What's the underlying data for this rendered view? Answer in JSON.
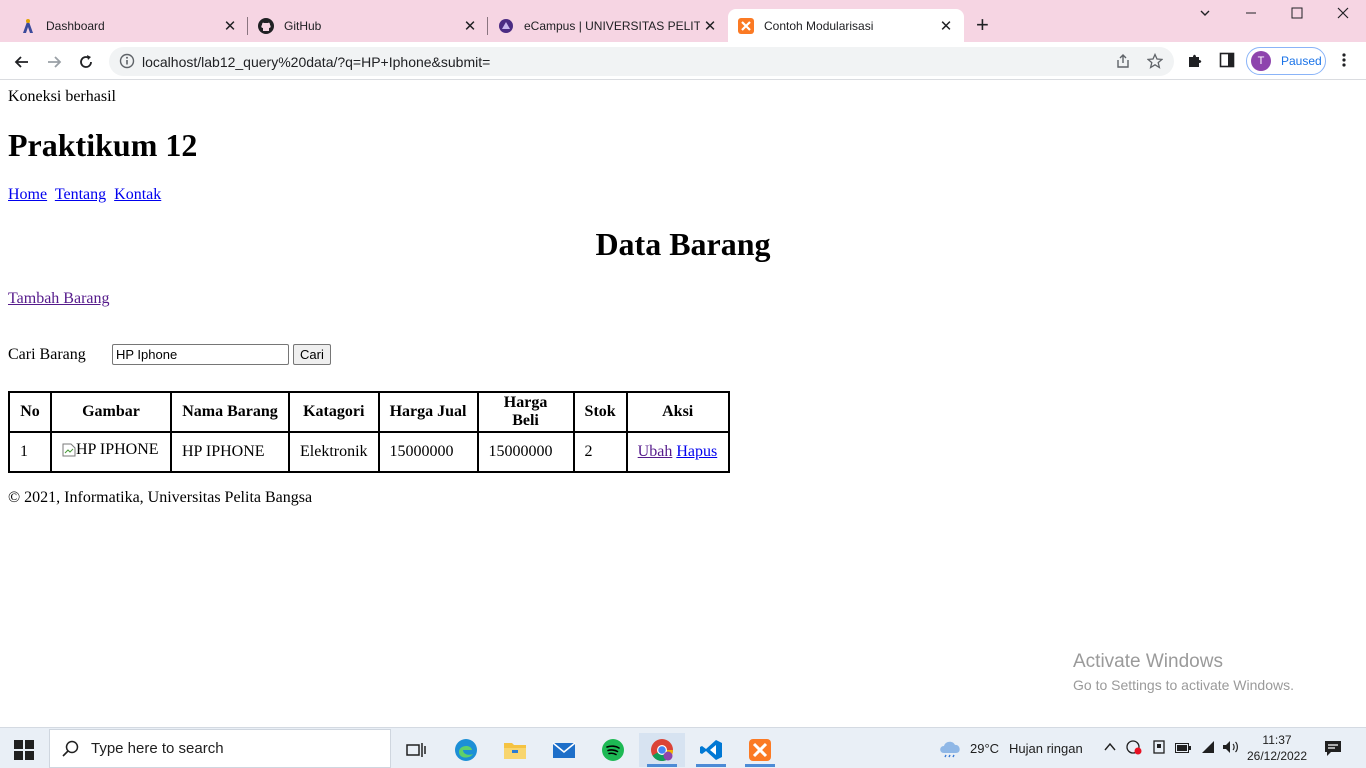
{
  "browser": {
    "tabs": [
      {
        "title": "Dashboard",
        "active": false
      },
      {
        "title": "GitHub",
        "active": false
      },
      {
        "title": "eCampus | UNIVERSITAS PELITA B",
        "active": false
      },
      {
        "title": "Contoh Modularisasi",
        "active": true
      }
    ],
    "address_url": "localhost/lab12_query%20data/?q=HP+Iphone&submit=",
    "profile_initial": "T",
    "profile_status": "Paused"
  },
  "page": {
    "connection_status": "Koneksi berhasil",
    "site_title": "Praktikum 12",
    "nav_links": [
      "Home",
      "Tentang",
      "Kontak"
    ],
    "heading": "Data Barang",
    "add_link": "Tambah Barang",
    "search": {
      "label": "Cari Barang",
      "value": "HP Iphone",
      "button": "Cari"
    },
    "table": {
      "headers": [
        "No",
        "Gambar",
        "Nama Barang",
        "Katagori",
        "Harga Jual",
        "Harga Beli",
        "Stok",
        "Aksi"
      ],
      "rows": [
        {
          "no": "1",
          "gambar_alt": "HP IPHONE",
          "nama": "HP IPHONE",
          "kategori": "Elektronik",
          "harga_jual": "15000000",
          "harga_beli": "15000000",
          "stok": "2",
          "ubah": "Ubah",
          "hapus": "Hapus"
        }
      ]
    },
    "footer": "© 2021, Informatika, Universitas Pelita Bangsa"
  },
  "watermark": {
    "line1": "Activate Windows",
    "line2": "Go to Settings to activate Windows."
  },
  "taskbar": {
    "search_placeholder": "Type here to search",
    "weather_temp": "29°C",
    "weather_desc": "Hujan ringan",
    "time": "11:37",
    "date": "26/12/2022"
  },
  "colors": {
    "tabstrip": "#f6d5e3",
    "link": "#0000ee",
    "visited_link": "#551a8b",
    "taskbar": "#e9eff6"
  }
}
